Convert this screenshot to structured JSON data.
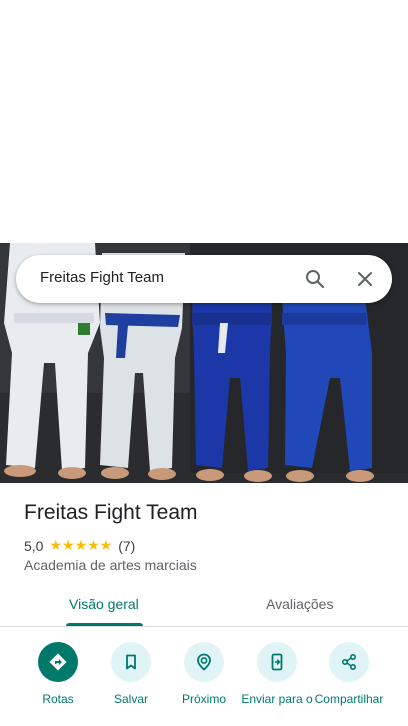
{
  "search": {
    "query": "Freitas Fight Team"
  },
  "place": {
    "name": "Freitas Fight Team",
    "rating": "5,0",
    "stars": "★★★★★",
    "review_count": "(7)",
    "category": "Academia de artes marciais"
  },
  "tabs": [
    {
      "label": "Visão geral",
      "selected": true
    },
    {
      "label": "Avaliações",
      "selected": false
    }
  ],
  "actions": [
    {
      "label": "Rotas",
      "icon": "directions-icon"
    },
    {
      "label": "Salvar",
      "icon": "bookmark-icon"
    },
    {
      "label": "Próximo",
      "icon": "nearby-icon"
    },
    {
      "label": "Enviar para o",
      "icon": "send-to-phone-icon"
    },
    {
      "label": "Compartilhar",
      "icon": "share-icon"
    }
  ],
  "colors": {
    "accent": "#00796b",
    "action_bg": "#e0f4f7",
    "star": "#fbbc04"
  }
}
